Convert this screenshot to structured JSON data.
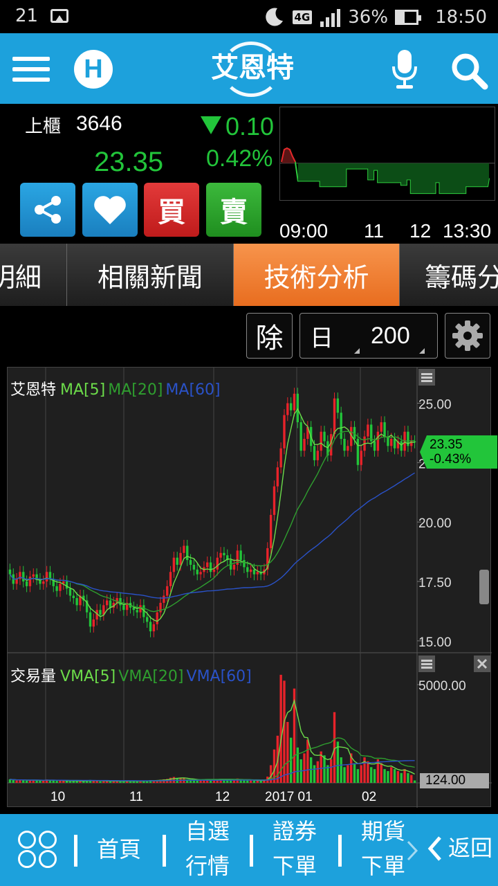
{
  "status_bar": {
    "notif_count": "21",
    "network": "4G",
    "battery": "36%",
    "time": "18:50"
  },
  "app_bar": {
    "title": "艾恩特"
  },
  "quote": {
    "market": "上櫃",
    "code": "3646",
    "change": "0.10",
    "price": "23.35",
    "change_pct": "0.42%",
    "buttons": {
      "buy": "買",
      "sell": "賣"
    },
    "mini_axis": [
      "09:00",
      "11",
      "12",
      "13:30"
    ]
  },
  "tabs": [
    {
      "label": "明細",
      "active": false
    },
    {
      "label": "相關新聞",
      "active": false
    },
    {
      "label": "技術分析",
      "active": true
    },
    {
      "label": "籌碼分析",
      "active": false
    }
  ],
  "toolbar": {
    "exright": "除",
    "period": "日",
    "count": "200"
  },
  "chart": {
    "price_legend": {
      "name": "艾恩特",
      "ma5": "MA[5]",
      "ma20": "MA[20]",
      "ma60": "MA[60]"
    },
    "price_ticks": [
      "25.00",
      "22.50",
      "20.00",
      "17.50",
      "15.00"
    ],
    "price_tag": {
      "price": "23.35",
      "pct": "-0.43%"
    },
    "volume_legend": {
      "name": "交易量",
      "vma5": "VMA[5]",
      "vma20": "VMA[20]",
      "vma60": "VMA[60]"
    },
    "volume_ticks": [
      "5000.00"
    ],
    "volume_tag": "124.00",
    "x_labels": [
      "10",
      "11",
      "12",
      "2017 01",
      "02"
    ],
    "colors": {
      "up": "#e8232a",
      "down": "#22c53a",
      "ma5": "#6cdc4a",
      "ma20": "#2f9e2f",
      "ma60": "#2a52c8"
    }
  },
  "chart_data": {
    "type": "candlestick",
    "x_labels": [
      "10",
      "11",
      "12",
      "2017 01",
      "02"
    ],
    "y_ticks": [
      25.0,
      22.5,
      20.0,
      17.5,
      15.0
    ],
    "ylim": [
      14.5,
      26.5
    ],
    "last_price": 23.35,
    "series": [
      {
        "name": "MA[5]"
      },
      {
        "name": "MA[20]"
      },
      {
        "name": "MA[60]"
      },
      {
        "name": "VMA[5]"
      },
      {
        "name": "VMA[20]"
      },
      {
        "name": "VMA[60]"
      }
    ],
    "closes": [
      17.8,
      17.4,
      17.6,
      17.9,
      17.5,
      17.3,
      17.7,
      17.8,
      17.6,
      17.4,
      17.5,
      17.9,
      17.6,
      17.3,
      17.1,
      17.4,
      17.5,
      17.2,
      16.9,
      16.8,
      16.5,
      16.9,
      16.7,
      16.2,
      15.6,
      15.9,
      16.3,
      16.1,
      16.5,
      16.7,
      16.4,
      16.6,
      16.8,
      16.5,
      16.3,
      16.6,
      16.4,
      16.3,
      16.2,
      16.5,
      16.0,
      15.8,
      15.4,
      15.7,
      16.2,
      16.6,
      16.9,
      17.3,
      17.9,
      18.5,
      18.2,
      18.7,
      19.0,
      18.4,
      18.2,
      18.0,
      17.8,
      17.9,
      18.1,
      18.3,
      17.9,
      18.0,
      18.5,
      18.7,
      18.6,
      18.4,
      18.0,
      18.2,
      18.8,
      18.4,
      18.1,
      17.9,
      18.0,
      17.8,
      17.9,
      17.8,
      18.0,
      18.9,
      20.3,
      21.5,
      22.3,
      23.1,
      24.5,
      25.0,
      24.7,
      25.4,
      24.2,
      23.0,
      23.5,
      24.0,
      23.2,
      22.6,
      23.0,
      23.8,
      23.4,
      22.8,
      23.7,
      25.2,
      24.6,
      23.5,
      23.0,
      23.2,
      24.0,
      23.5,
      22.4,
      23.0,
      23.6,
      24.1,
      23.4,
      23.0,
      23.8,
      24.2,
      23.6,
      23.2,
      23.5,
      23.1,
      23.4,
      23.0,
      23.8,
      23.2,
      23.4,
      23.35
    ],
    "volumes": [
      180,
      150,
      120,
      160,
      140,
      110,
      130,
      150,
      120,
      100,
      130,
      170,
      140,
      120,
      100,
      110,
      130,
      90,
      80,
      110,
      90,
      100,
      80,
      120,
      150,
      90,
      110,
      80,
      100,
      90,
      80,
      100,
      90,
      70,
      80,
      100,
      90,
      80,
      70,
      90,
      100,
      120,
      140,
      110,
      130,
      160,
      180,
      200,
      260,
      300,
      220,
      250,
      230,
      180,
      160,
      150,
      140,
      130,
      160,
      170,
      140,
      150,
      190,
      210,
      180,
      160,
      140,
      150,
      220,
      170,
      130,
      120,
      140,
      110,
      120,
      110,
      130,
      320,
      900,
      1700,
      2400,
      5500,
      5200,
      3100,
      2300,
      4800,
      1800,
      1200,
      1500,
      2200,
      1300,
      900,
      1100,
      1600,
      1400,
      900,
      1200,
      3600,
      2100,
      1300,
      800,
      900,
      1500,
      1000,
      700,
      900,
      1300,
      1100,
      800,
      700,
      1200,
      1000,
      700,
      600,
      800,
      700,
      600,
      500,
      700,
      500,
      400,
      124
    ]
  }
}
